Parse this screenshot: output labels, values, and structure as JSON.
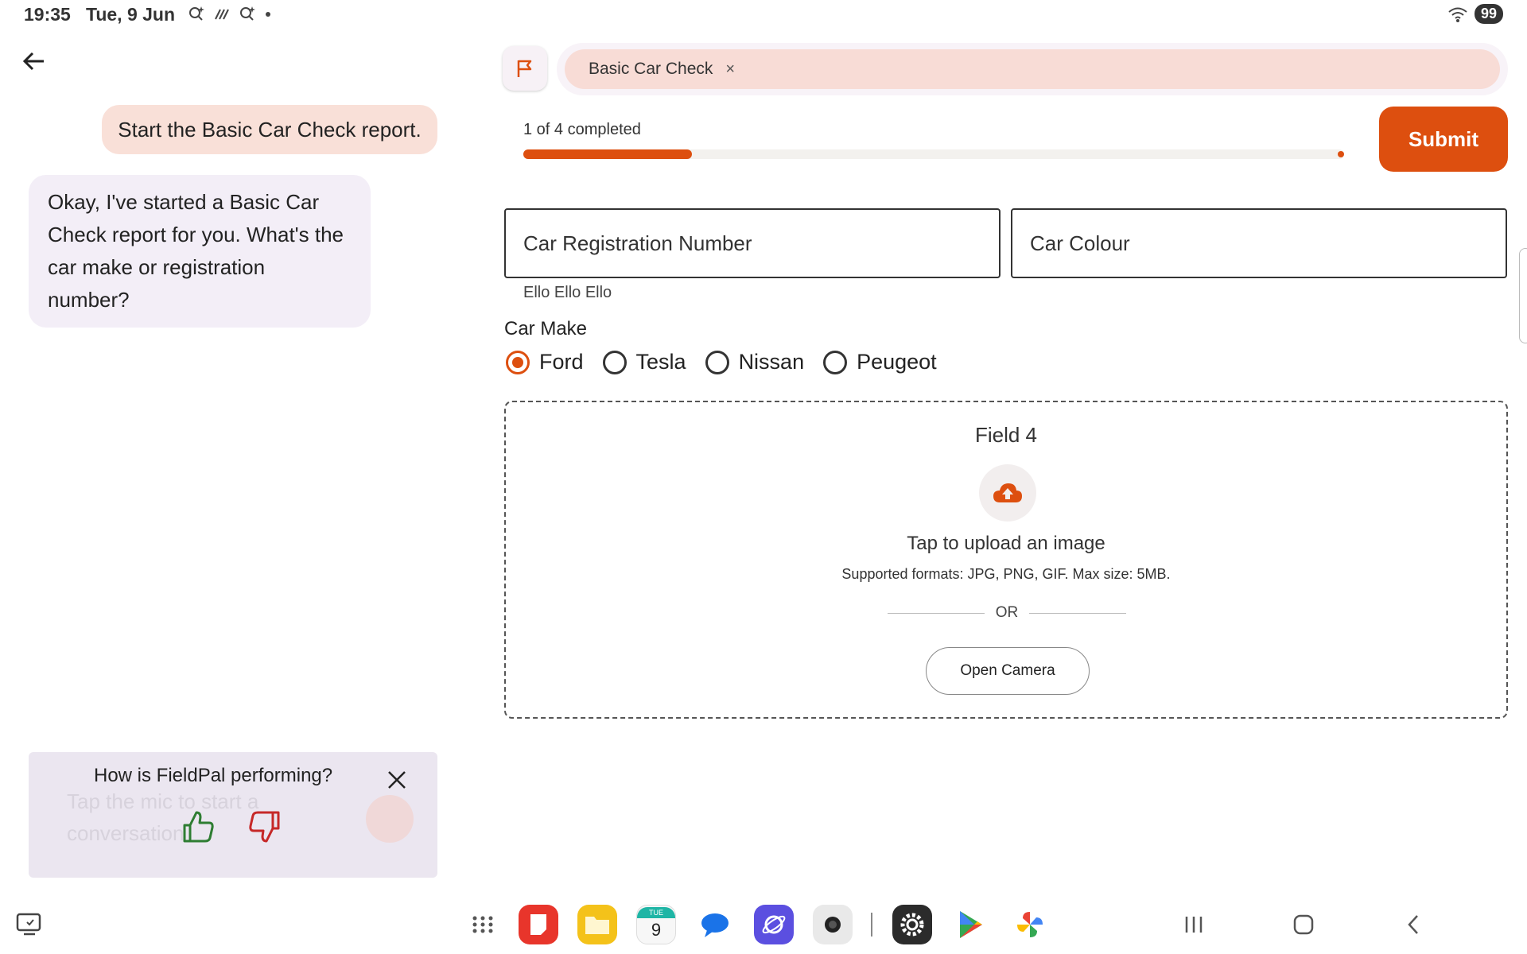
{
  "status_bar": {
    "time": "19:35",
    "date": "Tue, 9 Jun",
    "battery": "99",
    "icons": [
      "search-sparkle-icon",
      "signal-lines-icon",
      "search-sparkle-icon",
      "dot-icon",
      "wifi-icon"
    ]
  },
  "chat": {
    "user_message": "Start the Basic Car Check report.",
    "bot_message": "Okay, I've started a Basic Car Check report for you. What's the car make or registration number?",
    "input_placeholder": "Tap the mic to start a conversation"
  },
  "feedback": {
    "question": "How is FieldPal performing?"
  },
  "form": {
    "tab_label": "Basic Car Check",
    "tab_close": "×",
    "progress_text": "1 of 4 completed",
    "progress_fraction": 0.25,
    "submit_label": "Submit",
    "registration_placeholder": "Car Registration Number",
    "registration_helper": "Ello Ello Ello",
    "colour_placeholder": "Car Colour",
    "car_make_label": "Car Make",
    "car_make_options": [
      "Ford",
      "Tesla",
      "Nissan",
      "Peugeot"
    ],
    "car_make_selected": "Ford",
    "upload": {
      "title": "Field 4",
      "tap_text": "Tap to upload an image",
      "formats_text": "Supported formats: JPG, PNG, GIF. Max size: 5MB.",
      "or_text": "OR",
      "camera_button": "Open Camera"
    }
  },
  "dock": {
    "calendar_day": "TUE",
    "calendar_date": "9"
  },
  "colors": {
    "accent": "#dd4f0f",
    "user_bubble": "#f9e0d8",
    "bot_bubble": "#f3eef7",
    "feedback_card": "#ebe6f0",
    "thumb_up": "#2e7d32",
    "thumb_down": "#c62828"
  }
}
